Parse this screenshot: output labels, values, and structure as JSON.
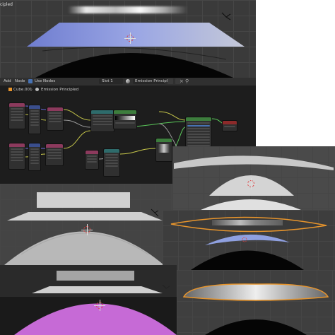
{
  "viewport_top": {
    "label": "cipled"
  },
  "node_editor": {
    "header_menu": [
      "Add",
      "Node"
    ],
    "use_nodes_label": "Use Nodes",
    "use_nodes_checked": true,
    "slot_label": "Slot 1",
    "material_name": "Emission Principled",
    "breadcrumb_object": "Cube.001",
    "breadcrumb_material": "Emission Principled"
  },
  "colors": {
    "accent_blue": "#4772b3",
    "selection_orange": "#e8952c",
    "background_magenta": "#c66ad6",
    "plane_blue": "#8fa0e0",
    "node_group_green": "#3d7d3d",
    "node_shader_teal": "#2e6b6b",
    "node_texture_pink": "#8c3a5d"
  }
}
